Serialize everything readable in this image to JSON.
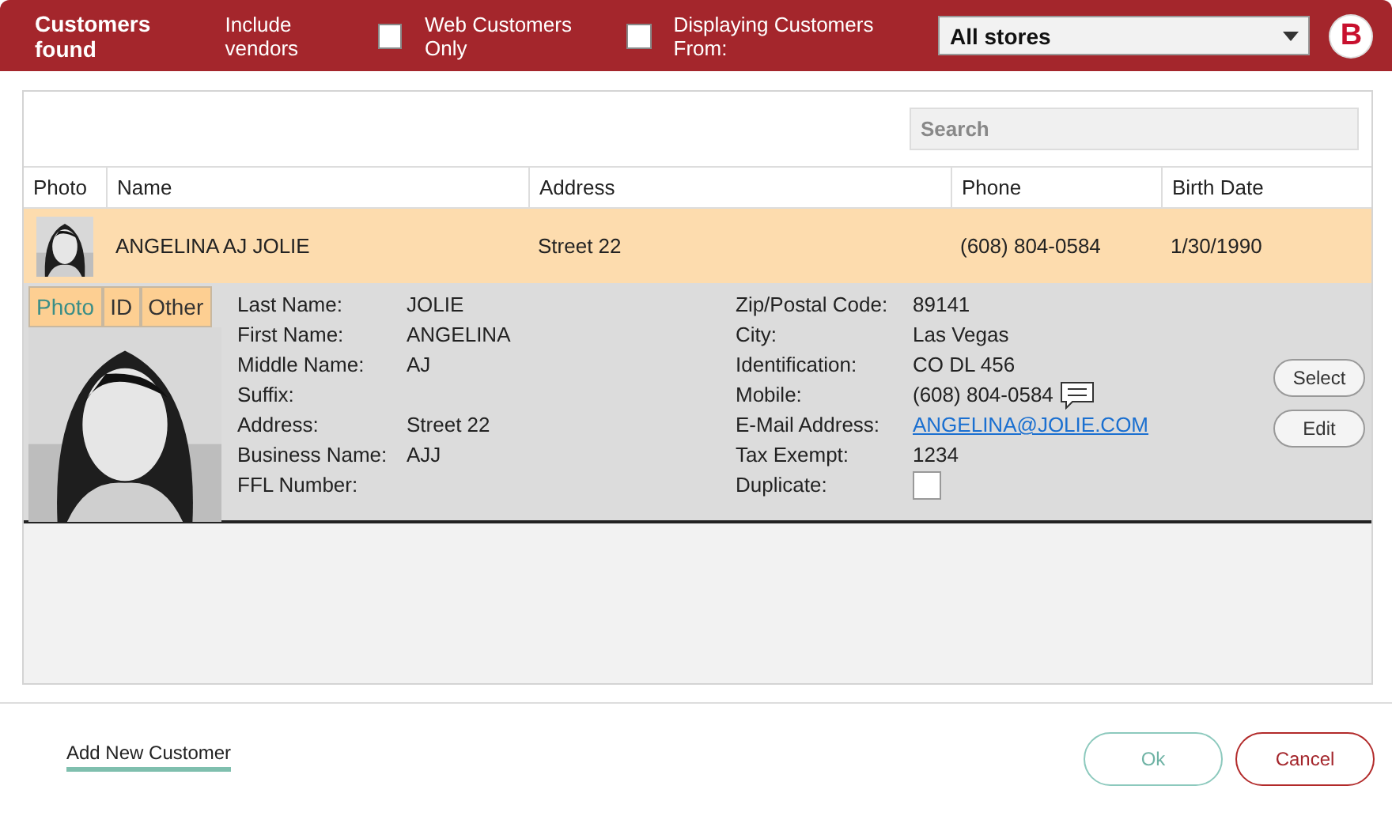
{
  "header": {
    "title": "Customers found",
    "filters": [
      {
        "label": "Include vendors",
        "checked": false
      },
      {
        "label": "Web Customers Only",
        "checked": false
      }
    ],
    "store_label": "Displaying Customers From:",
    "store_value": "All stores",
    "brand_mark": "B"
  },
  "search": {
    "placeholder": "Search"
  },
  "table": {
    "columns": [
      "Photo",
      "Name",
      "Address",
      "Phone",
      "Birth Date"
    ],
    "rows": [
      {
        "selected": true,
        "name": "ANGELINA AJ JOLIE",
        "address": "Street 22",
        "phone": "(608) 804-0584",
        "birth_date": "1/30/1990"
      }
    ]
  },
  "detail": {
    "tabs": [
      {
        "label": "Photo",
        "selected": true
      },
      {
        "label": "ID",
        "selected": false
      },
      {
        "label": "Other",
        "selected": false
      }
    ],
    "left_fields": [
      {
        "label": "Last Name:",
        "value": "JOLIE"
      },
      {
        "label": "First Name:",
        "value": "ANGELINA"
      },
      {
        "label": "Middle Name:",
        "value": "AJ"
      },
      {
        "label": "Suffix:"
      },
      {
        "label": "Address:",
        "value": "Street 22"
      },
      {
        "label": "Business Name:",
        "value": "AJJ"
      },
      {
        "label": "FFL Number:"
      }
    ],
    "right_fields": [
      {
        "label": "Zip/Postal Code:",
        "value": "89141",
        "kind": "text"
      },
      {
        "label": "City:",
        "value": "Las Vegas",
        "kind": "text"
      },
      {
        "label": "Identification:",
        "value": "CO DL 456",
        "kind": "text"
      },
      {
        "label": "Mobile:",
        "value": "(608) 804-0584",
        "kind": "phone"
      },
      {
        "label": "E-Mail Address:",
        "value": "ANGELINA@JOLIE.COM",
        "kind": "link"
      },
      {
        "label": "Tax Exempt:",
        "value": "1234",
        "kind": "text"
      },
      {
        "label": "Duplicate:",
        "checked": false,
        "kind": "checkbox"
      }
    ],
    "buttons": [
      "Select",
      "Edit"
    ]
  },
  "footer": {
    "link": "Add New Customer",
    "ok": "Ok",
    "cancel": "Cancel"
  }
}
